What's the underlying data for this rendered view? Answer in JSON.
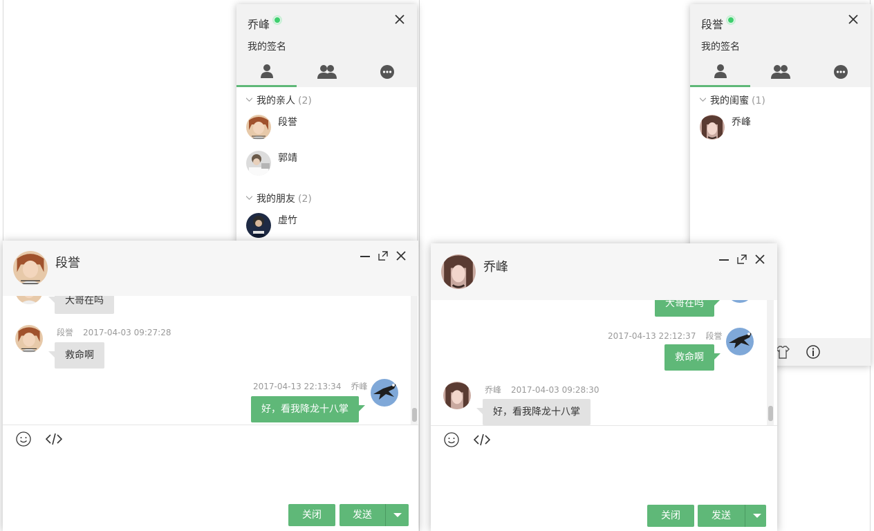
{
  "colors": {
    "accent": "#5fb878",
    "online": "#3ecf6e",
    "bubble_in": "#e2e2e2",
    "header_bg": "#f2f2f2"
  },
  "panel_qiaofeng": {
    "username": "乔峰",
    "signature": "我的签名",
    "tabs": [
      "friends-icon",
      "group-icon",
      "history-icon"
    ],
    "groups": [
      {
        "title": "我的亲人",
        "count": "(2)",
        "friends": [
          "段誉",
          "郭靖"
        ]
      },
      {
        "title": "我的朋友",
        "count": "(2)",
        "friends": [
          "虚竹"
        ]
      }
    ]
  },
  "panel_duanyu": {
    "username": "段誉",
    "signature": "我的签名",
    "tabs": [
      "friends-icon",
      "group-icon",
      "history-icon"
    ],
    "groups": [
      {
        "title": "我的闺蜜",
        "count": "(1)",
        "friends": [
          "乔峰"
        ]
      }
    ],
    "footer_icons": [
      "skin-icon",
      "info-icon"
    ]
  },
  "chat_left": {
    "title": "段誉",
    "messages": [
      {
        "dir": "in",
        "text": "大哥在吗"
      },
      {
        "dir": "in",
        "sender": "段誉",
        "time": "2017-04-03 09:27:28",
        "text": "救命啊"
      },
      {
        "dir": "out",
        "sender": "乔峰",
        "time": "2017-04-13 22:13:34",
        "text": "好，看我降龙十八掌"
      }
    ],
    "close_label": "关闭",
    "send_label": "发送"
  },
  "chat_right": {
    "title": "乔峰",
    "messages": [
      {
        "dir": "out",
        "text": "大哥在吗"
      },
      {
        "dir": "out",
        "sender": "段誉",
        "time": "2017-04-13 22:12:37",
        "text": "救命啊"
      },
      {
        "dir": "in",
        "sender": "乔峰",
        "time": "2017-04-03 09:28:30",
        "text": "好，看我降龙十八掌"
      }
    ],
    "close_label": "关闭",
    "send_label": "发送"
  }
}
